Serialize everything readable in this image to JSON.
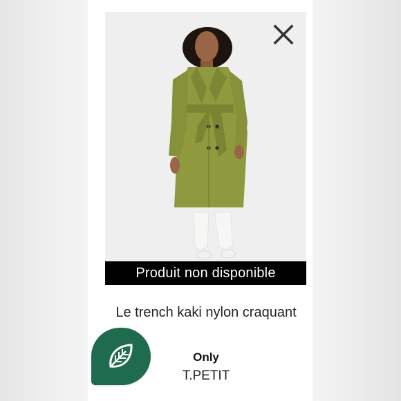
{
  "product": {
    "availability_banner": "Produit non disponible",
    "title": "Le trench kaki nylon craquant",
    "brand": "Only",
    "size": "T.PETIT"
  },
  "icons": {
    "close": "close-icon",
    "eco": "leaf-icon"
  },
  "colors": {
    "coat": "#8f9a3e",
    "banner": "#000000",
    "eco_badge": "#1f6b4d"
  }
}
